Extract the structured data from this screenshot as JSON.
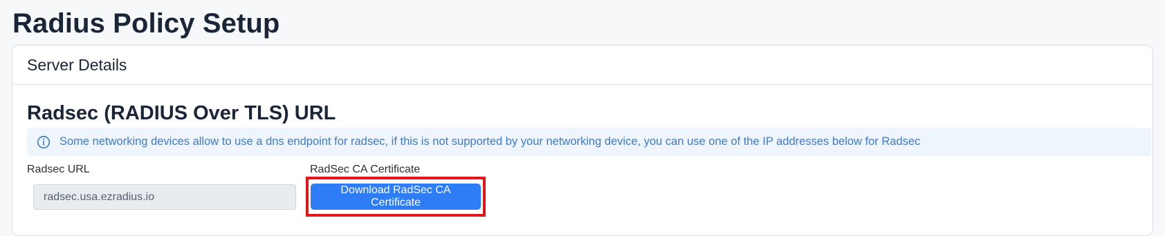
{
  "page": {
    "title": "Radius Policy Setup"
  },
  "card": {
    "header": "Server Details",
    "section_title": "Radsec (RADIUS Over TLS) URL",
    "info": {
      "icon": "info-icon",
      "text": "Some networking devices allow to use a dns endpoint for radsec, if this is not supported by your networking device, you can use one of the IP addresses below for Radsec"
    },
    "fields": {
      "radsec_url": {
        "label": "Radsec URL",
        "value": "radsec.usa.ezradius.io"
      },
      "radsec_ca": {
        "label": "RadSec CA Certificate",
        "button": "Download RadSec CA Certificate"
      }
    }
  },
  "colors": {
    "page_background": "#f7f8fa",
    "card_background": "#ffffff",
    "text_primary": "#1b2538",
    "info_background": "#eef5fc",
    "info_text": "#3f7bc8",
    "primary_button": "#2f7df6",
    "highlight_outline": "#e4141b"
  }
}
